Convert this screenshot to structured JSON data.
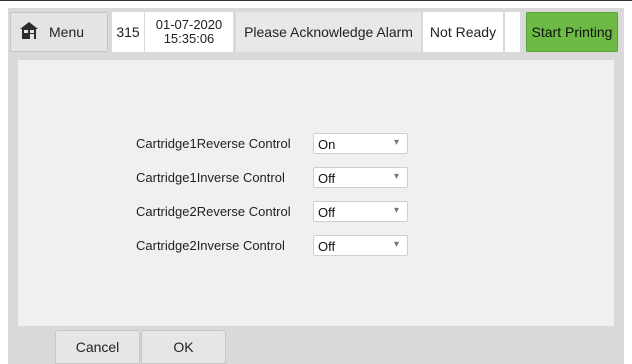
{
  "header": {
    "menu_label": "Menu",
    "menu_icon": "home-icon",
    "count": "315",
    "date": "01-07-2020",
    "time": "15:35:06",
    "alarm_text": "Please Acknowledge Alarm",
    "status_text": "Not Ready",
    "start_label": "Start Printing"
  },
  "settings": [
    {
      "label": "Cartridge1Reverse Control",
      "value": "On"
    },
    {
      "label": "Cartridge1Inverse Control",
      "value": "Off"
    },
    {
      "label": "Cartridge2Reverse Control",
      "value": "Off"
    },
    {
      "label": "Cartridge2Inverse Control",
      "value": "Off"
    }
  ],
  "footer": {
    "cancel_label": "Cancel",
    "ok_label": "OK"
  },
  "colors": {
    "start_button": "#6dbb45",
    "panel_bg": "#d9d9d9",
    "content_bg": "#f0f0f0"
  }
}
